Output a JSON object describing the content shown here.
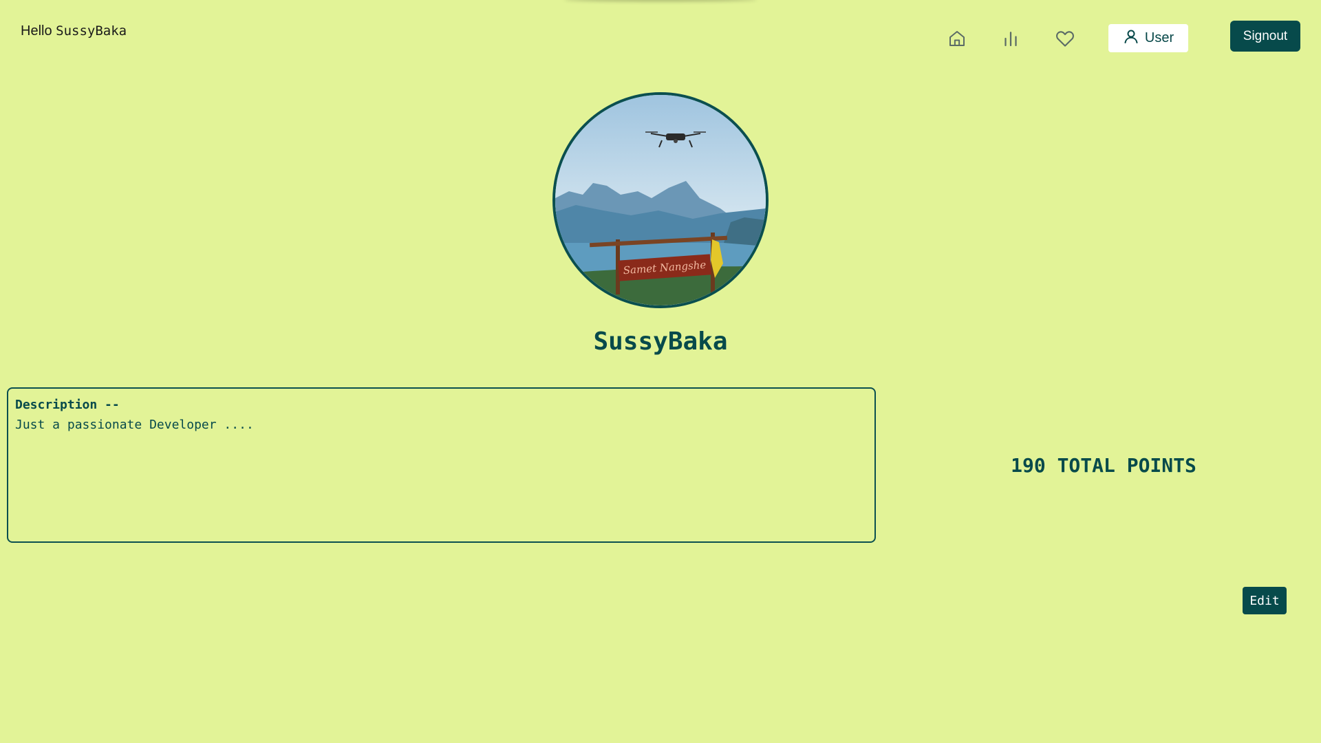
{
  "header": {
    "greeting_prefix": "Hello",
    "greeting_username": "SussyBaka",
    "nav_icons": [
      "home-icon",
      "leaderboard-icon",
      "heart-icon"
    ],
    "user_button_label": "User",
    "signout_label": "Signout"
  },
  "profile": {
    "name": "SussyBaka",
    "description_heading": "Description --",
    "description_text": "Just a passionate Developer ....",
    "total_points": "190 TOTAL POINTS",
    "edit_label": "Edit"
  },
  "colors": {
    "background": "#e2f397",
    "primary": "#074a4b",
    "button_text": "#ffffff",
    "user_button_bg": "#ffffff"
  }
}
